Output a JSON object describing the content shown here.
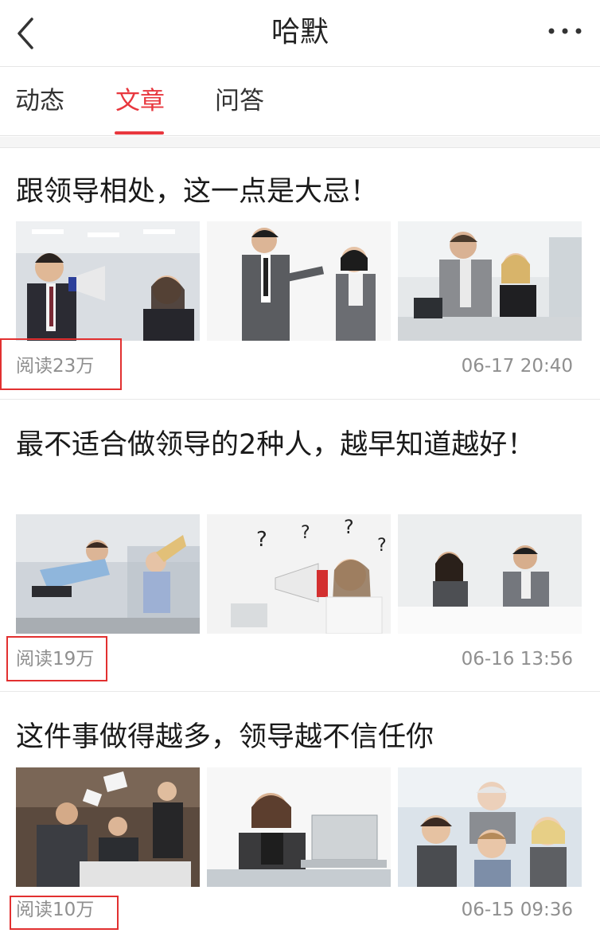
{
  "header": {
    "title": "哈默",
    "back_icon": "chevron-left-icon",
    "more_icon": "more-horizontal-icon"
  },
  "tabs": [
    {
      "label": "动态",
      "active": false
    },
    {
      "label": "文章",
      "active": true
    },
    {
      "label": "问答",
      "active": false
    }
  ],
  "colors": {
    "accent": "#e8373e",
    "annotation_box": "#e23030",
    "meta_text": "#8f8f8f"
  },
  "articles": [
    {
      "title": "跟领导相处，这一点是大忌！",
      "thumbnails": [
        "boss-shouting-megaphone-photo",
        "man-pointing-woman-covering-ears-photo",
        "colleagues-at-computer-photo"
      ],
      "reads": "阅读23万",
      "time": "06-17 20:40"
    },
    {
      "title": "最不适合做领导的2种人，越早知道越好！",
      "thumbnails": [
        "office-argument-photo",
        "woman-with-megaphone-question-marks-photo",
        "two-people-at-table-photo"
      ],
      "reads": "阅读19万",
      "time": "06-16 13:56"
    },
    {
      "title": "这件事做得越多，领导越不信任你",
      "thumbnails": [
        "boss-meeting-papers-flying-photo",
        "woman-with-laptop-photo",
        "nervous-employees-biting-nails-photo"
      ],
      "reads": "阅读10万",
      "time": "06-15 09:36"
    }
  ]
}
